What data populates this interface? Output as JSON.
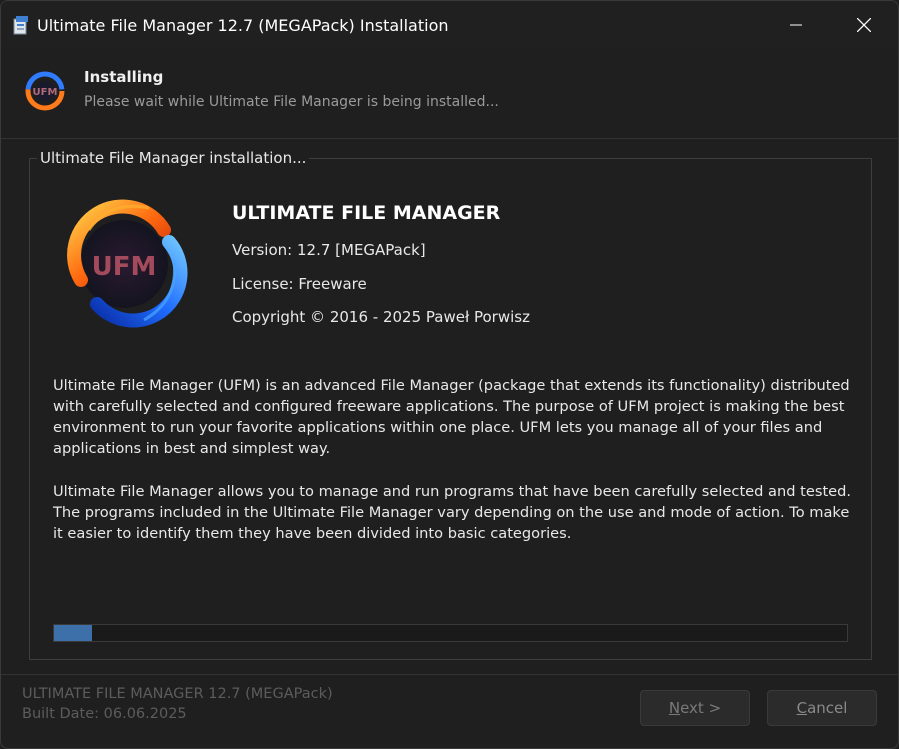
{
  "window": {
    "title": "Ultimate File Manager 12.7 (MEGAPack) Installation"
  },
  "header": {
    "title": "Installing",
    "subtitle": "Please wait while Ultimate File Manager is being installed..."
  },
  "group": {
    "label": "Ultimate File Manager installation..."
  },
  "product": {
    "logo_text": "UFM",
    "name": "ULTIMATE FILE MANAGER",
    "version": "Version: 12.7 [MEGAPack]",
    "license": "License: Freeware",
    "copyright": "Copyright © 2016 - 2025 Paweł Porwisz"
  },
  "description": {
    "paragraph1": "Ultimate File Manager (UFM) is an advanced File Manager (package that extends its functionality) distributed with carefully selected and configured freeware applications. The purpose of UFM project is making the best environment to run your favorite applications within one place. UFM lets you manage all of your files and applications in best and simplest way.",
    "paragraph2": "Ultimate File Manager allows you to manage and run programs that have been carefully selected and tested. The programs included in the Ultimate File Manager vary depending on the use and mode of action. To make it easier to identify them they have been divided into basic categories."
  },
  "progress": {
    "percent": 4.8,
    "color": "#3d6fa8"
  },
  "footer": {
    "version_text": "ULTIMATE FILE MANAGER 12.7 (MEGAPack)",
    "build_date": "Built Date: 06.06.2025"
  },
  "buttons": {
    "next_mnemonic": "N",
    "next_rest": "ext >",
    "cancel_mnemonic": "C",
    "cancel_rest": "ancel"
  },
  "icons": {
    "app": "installer-box-icon",
    "minimize": "minimize-icon",
    "close": "close-icon",
    "logo": "ufm-fire-ring-logo"
  }
}
